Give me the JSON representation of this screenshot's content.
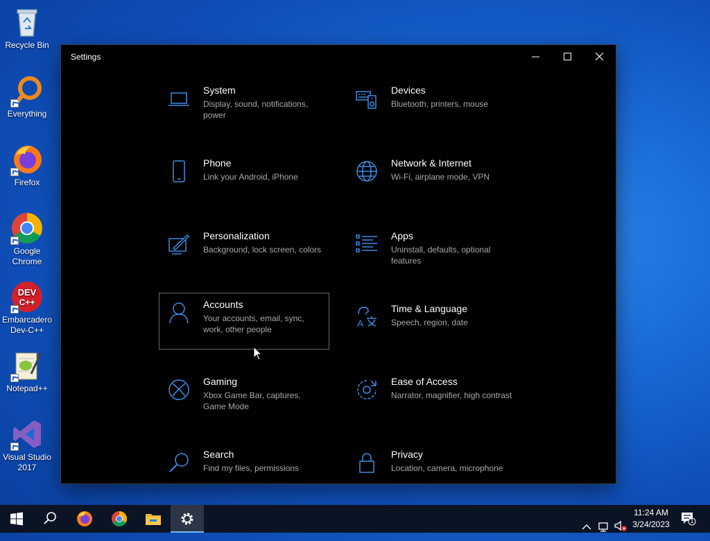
{
  "desktop": {
    "icons": [
      {
        "label": "Recycle Bin",
        "icon": "recycle-bin-icon"
      },
      {
        "label": "Everything",
        "icon": "everything-search-icon"
      },
      {
        "label": "Firefox",
        "icon": "firefox-icon"
      },
      {
        "label": "Google Chrome",
        "icon": "chrome-icon"
      },
      {
        "label": "Embarcadero Dev-C++",
        "icon": "devcpp-icon"
      },
      {
        "label": "Notepad++",
        "icon": "notepadpp-icon"
      },
      {
        "label": "Visual Studio 2017",
        "icon": "visual-studio-icon"
      }
    ]
  },
  "window": {
    "title": "Settings",
    "controls": {
      "minimize": "minimize-icon",
      "maximize": "maximize-icon",
      "close": "close-icon"
    }
  },
  "settings": {
    "tiles": [
      {
        "name": "System",
        "desc": "Display, sound, notifications, power",
        "icon": "laptop-icon"
      },
      {
        "name": "Devices",
        "desc": "Bluetooth, printers, mouse",
        "icon": "keyboard-speaker-icon"
      },
      {
        "name": "Phone",
        "desc": "Link your Android, iPhone",
        "icon": "phone-icon"
      },
      {
        "name": "Network & Internet",
        "desc": "Wi-Fi, airplane mode, VPN",
        "icon": "globe-icon"
      },
      {
        "name": "Personalization",
        "desc": "Background, lock screen, colors",
        "icon": "paint-icon"
      },
      {
        "name": "Apps",
        "desc": "Uninstall, defaults, optional features",
        "icon": "apps-list-icon"
      },
      {
        "name": "Accounts",
        "desc": "Your accounts, email, sync, work, other people",
        "icon": "person-icon"
      },
      {
        "name": "Time & Language",
        "desc": "Speech, region, date",
        "icon": "time-language-icon"
      },
      {
        "name": "Gaming",
        "desc": "Xbox Game Bar, captures, Game Mode",
        "icon": "xbox-icon"
      },
      {
        "name": "Ease of Access",
        "desc": "Narrator, magnifier, high contrast",
        "icon": "ease-of-access-icon"
      },
      {
        "name": "Search",
        "desc": "Find my files, permissions",
        "icon": "search-icon"
      },
      {
        "name": "Privacy",
        "desc": "Location, camera, microphone",
        "icon": "lock-icon"
      }
    ],
    "focused": "Accounts"
  },
  "taskbar": {
    "items": [
      "start-icon",
      "search-icon",
      "firefox-icon",
      "chrome-icon",
      "file-explorer-icon",
      "settings-gear-icon"
    ],
    "active": "settings-gear-icon",
    "tray": {
      "time": "11:24 AM",
      "date": "3/24/2023",
      "notifications": "1"
    }
  },
  "colors": {
    "accent": "#3a8ee6",
    "window_bg": "#000000",
    "desc_text": "#a9a9a9"
  }
}
